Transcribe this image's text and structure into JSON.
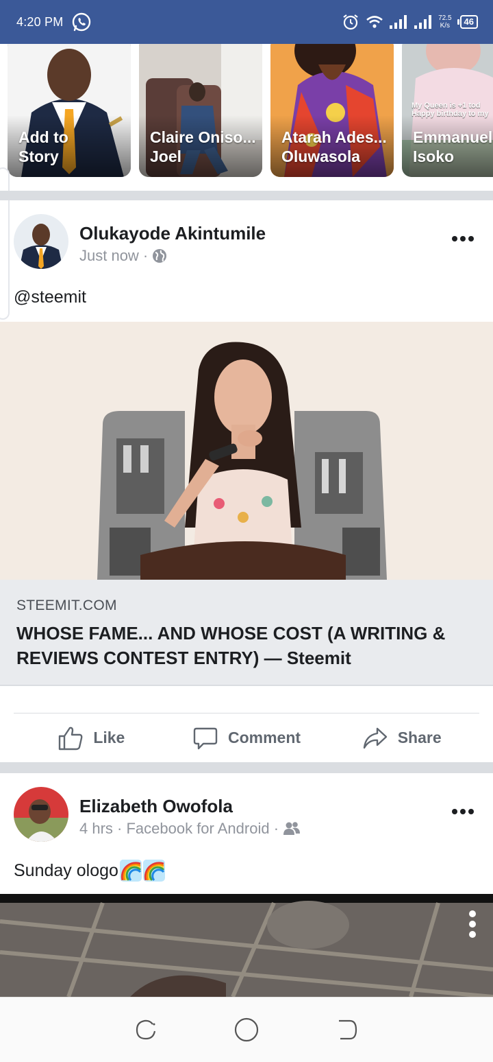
{
  "status_bar": {
    "time": "4:20 PM",
    "net_speed_value": "72.5",
    "net_speed_unit": "K/s",
    "battery": "46",
    "icons": [
      "whatsapp-icon",
      "alarm-icon",
      "wifi-icon",
      "signal-icon",
      "signal-icon"
    ]
  },
  "stories": [
    {
      "label": "Add to\nStory"
    },
    {
      "label": "Claire Oniso...\nJoel"
    },
    {
      "label": "Atarah Ades...\nOluwasola"
    },
    {
      "label": "Emmanuel\nIsoko",
      "overlay_text": "My Queen is +1 tod\nHappy birthday to my"
    }
  ],
  "post1": {
    "author": "Olukayode Akintumile",
    "time": "Just now",
    "separator": "·",
    "privacy_icon": "globe-icon",
    "text": "@steemit",
    "link": {
      "domain": "STEEMIT.COM",
      "title": "WHOSE FAME... AND WHOSE COST (A WRITING & REVIEWS CONTEST ENTRY) — Steemit"
    }
  },
  "actions": {
    "like": "Like",
    "comment": "Comment",
    "share": "Share"
  },
  "post2": {
    "author": "Elizabeth Owofola",
    "meta": "4 hrs · Facebook for Android ·",
    "privacy_icon": "friends-icon",
    "text": "Sunday ologo",
    "emoji": [
      "rainbow-emoji",
      "rainbow-emoji"
    ]
  },
  "colors": {
    "status_bar": "#3b5998",
    "divider": "#dadde1",
    "link_card": "#e9ebee",
    "muted_text": "#90949c"
  }
}
